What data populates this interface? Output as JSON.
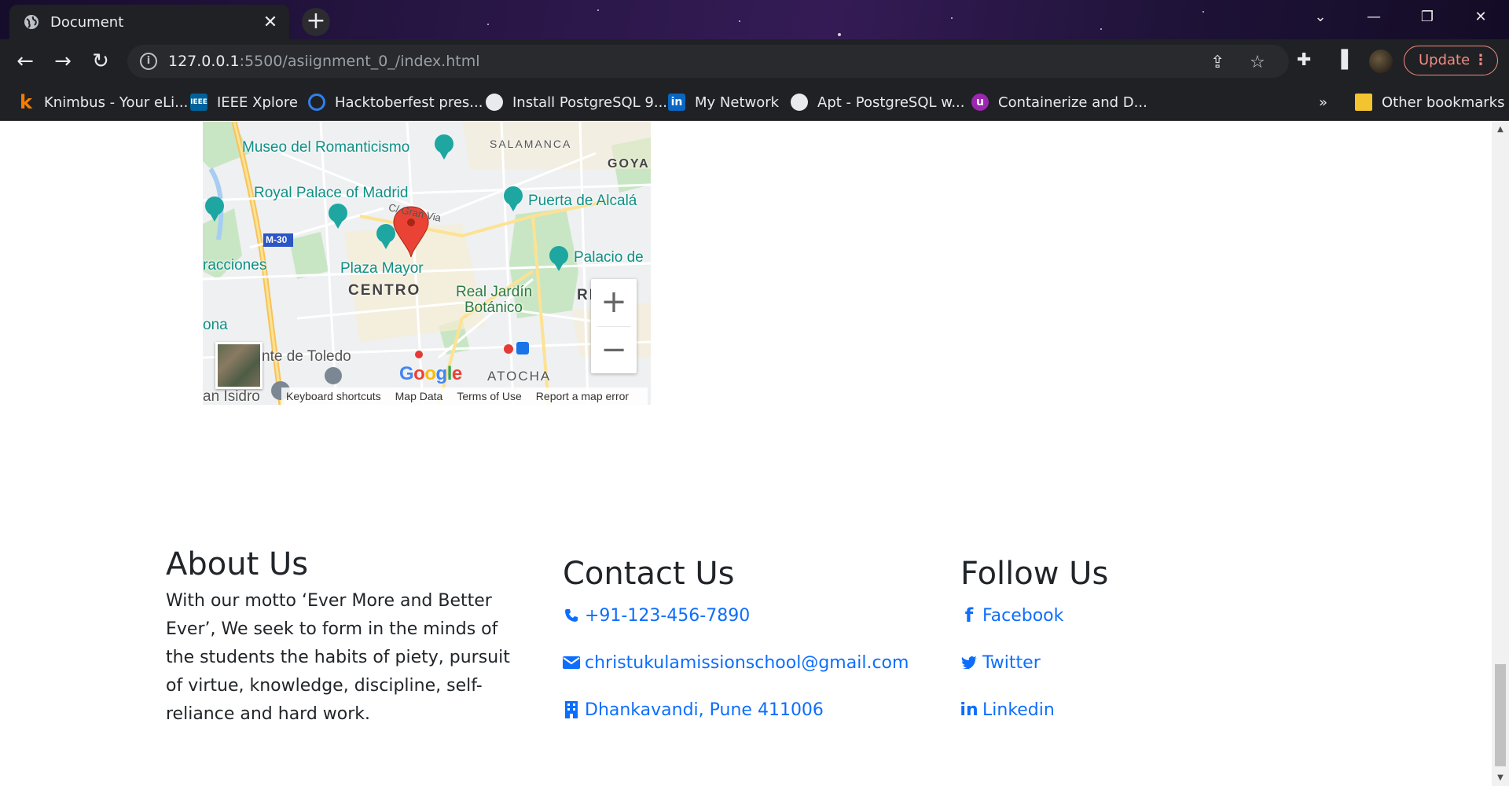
{
  "browser": {
    "tab_title": "Document",
    "url_host": "127.0.0.1",
    "url_path": ":5500/asiignment_0_/index.html",
    "update_label": "Update",
    "bookmarks": [
      {
        "label": "Knimbus - Your eLi...",
        "icon": "knimbus-icon"
      },
      {
        "label": "IEEE Xplore",
        "icon": "ieee-icon"
      },
      {
        "label": "Hacktoberfest pres...",
        "icon": "hacktoberfest-icon"
      },
      {
        "label": "Install PostgreSQL 9...",
        "icon": "globe-icon"
      },
      {
        "label": "My Network",
        "icon": "linkedin-icon"
      },
      {
        "label": "Apt - PostgreSQL w...",
        "icon": "globe-icon"
      },
      {
        "label": "Containerize and D...",
        "icon": "purple-extension-icon"
      }
    ],
    "more_bookmarks": "»",
    "other_bookmarks": "Other bookmarks"
  },
  "map": {
    "labels": {
      "museo": "Museo del Romanticismo",
      "salamanca": "SALAMANCA",
      "goya": "GOYA",
      "royal_palace": "Royal Palace of Madrid",
      "gran_via": "C/ Gran Via",
      "puerta": "Puerta de Alcalá",
      "m30": "M-30",
      "palacio": "Palacio de",
      "racciones": "racciones",
      "plaza_mayor": "Plaza Mayor",
      "centro": "CENTRO",
      "real_jardin": "Real Jardín",
      "botanico": "Botánico",
      "re": "RE",
      "ona": "ona",
      "toledo": "nte de Toledo",
      "atocha": "ATOCHA",
      "san_isidro": "an Isidro"
    },
    "google_letters": [
      "G",
      "o",
      "o",
      "g",
      "l",
      "e"
    ],
    "footer": {
      "shortcuts": "Keyboard shortcuts",
      "map_data": "Map Data",
      "terms": "Terms of Use",
      "report": "Report a map error"
    },
    "zoom_in": "+",
    "zoom_out": "−"
  },
  "footer": {
    "about": {
      "title": "About Us",
      "text": "With our motto ‘Ever More and Better Ever’, We seek to form in the minds of the students the habits of piety, pursuit of virtue, knowledge, discipline, self-reliance and hard work."
    },
    "contact": {
      "title": "Contact Us",
      "phone": "+91-123-456-7890",
      "email": "christukulamissionschool@gmail.com",
      "address": "Dhankavandi, Pune 411006"
    },
    "follow": {
      "title": "Follow Us",
      "facebook": "Facebook",
      "twitter": "Twitter",
      "linkedin": "Linkedin"
    }
  },
  "colors": {
    "link": "#0d6efd",
    "chrome_bg": "#202124",
    "update_accent": "#f28b82"
  }
}
